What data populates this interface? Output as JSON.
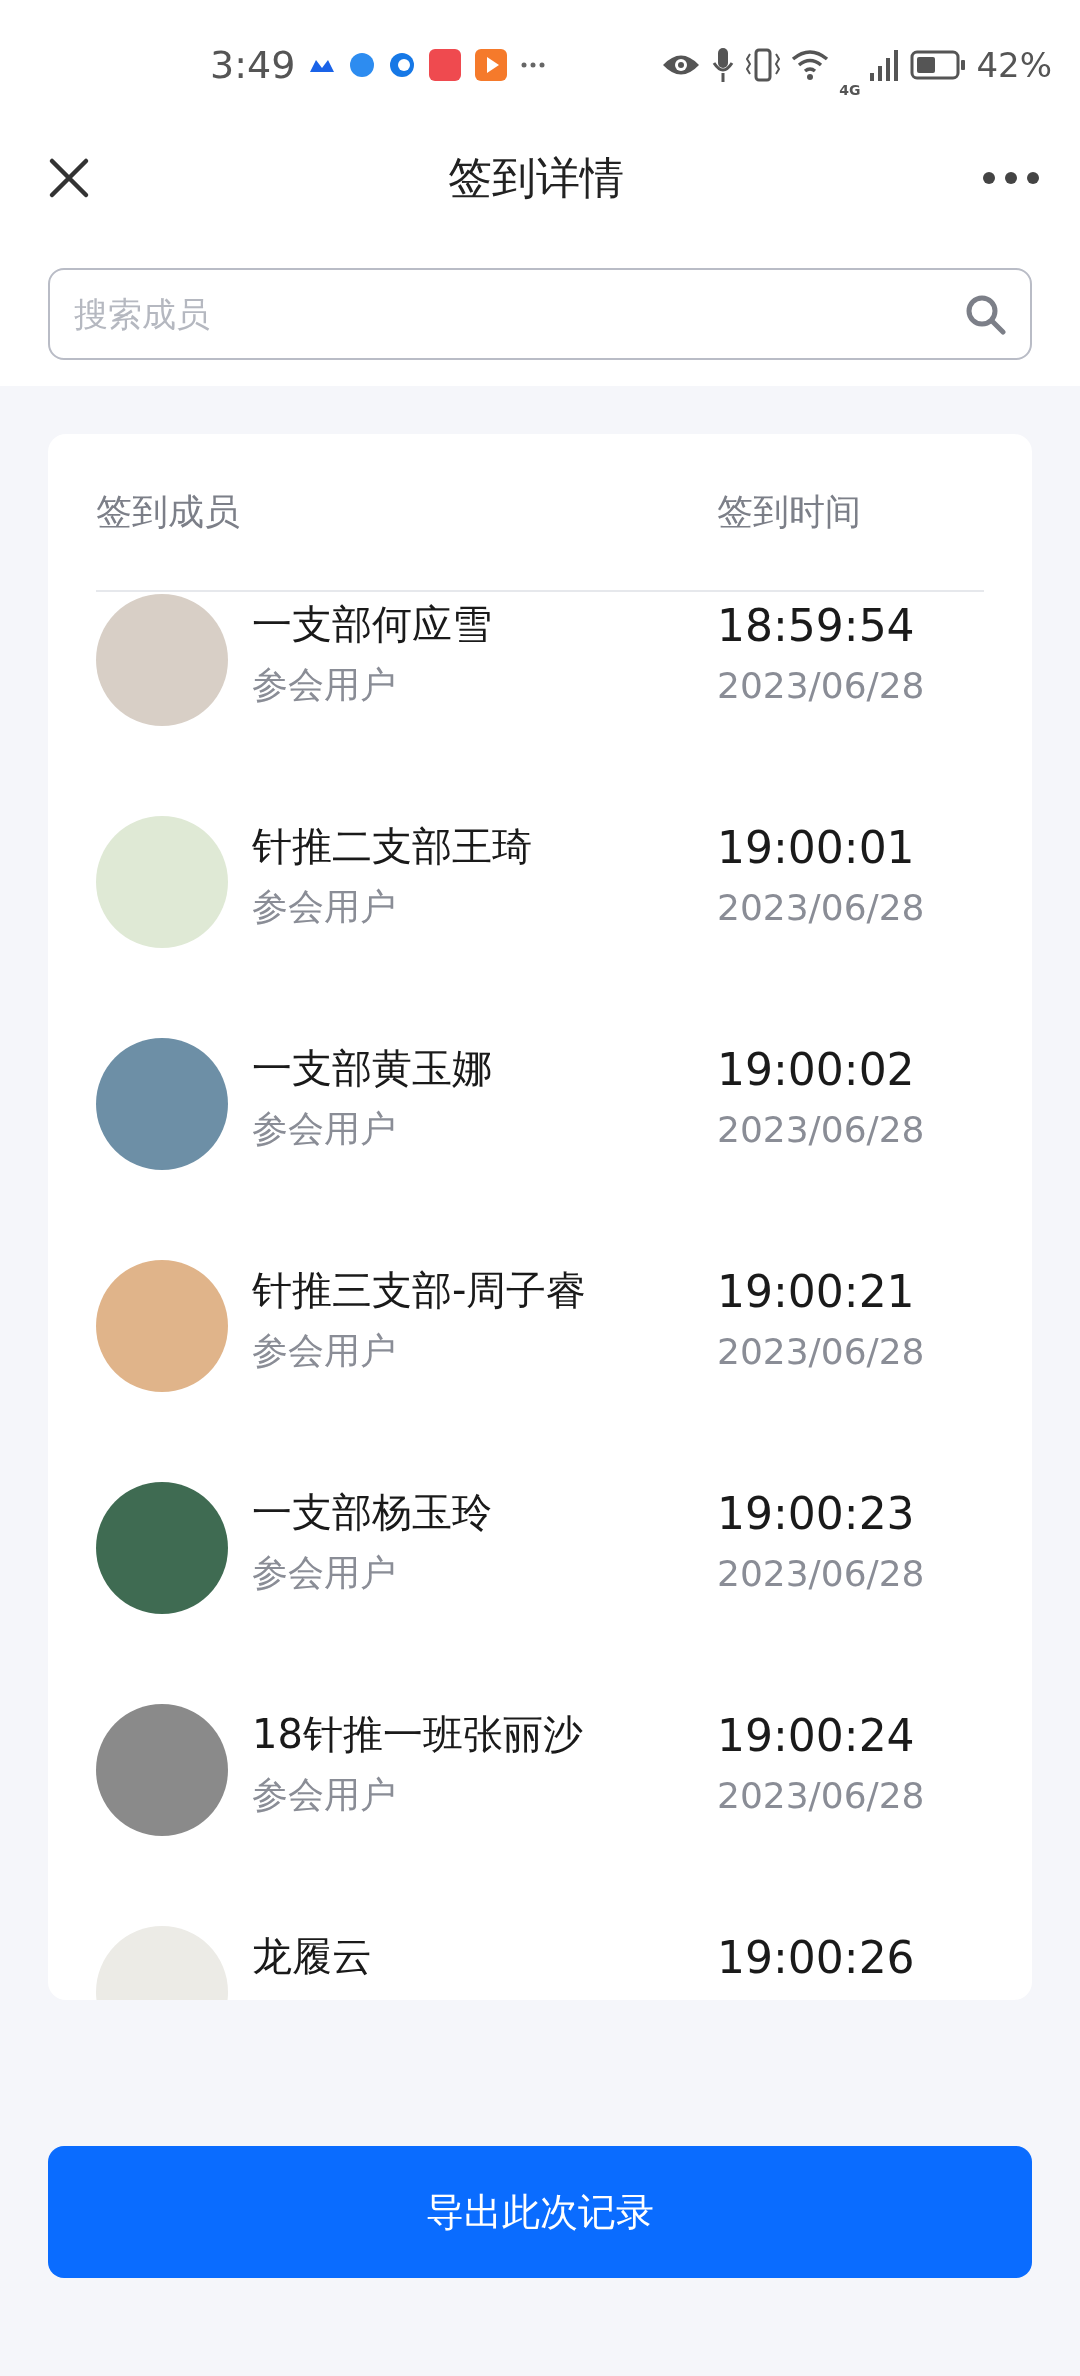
{
  "status_bar": {
    "time": "3:49",
    "battery": "42%",
    "network": "4G"
  },
  "header": {
    "title": "签到详情"
  },
  "search": {
    "placeholder": "搜索成员"
  },
  "table": {
    "columns": [
      "签到成员",
      "签到时间"
    ],
    "rows": [
      {
        "name": "一支部何应雪",
        "role": "参会用户",
        "time": "18:59:54",
        "date": "2023/06/28"
      },
      {
        "name": "针推二支部王琦",
        "role": "参会用户",
        "time": "19:00:01",
        "date": "2023/06/28"
      },
      {
        "name": "一支部黄玉娜",
        "role": "参会用户",
        "time": "19:00:02",
        "date": "2023/06/28"
      },
      {
        "name": "针推三支部-周子睿",
        "role": "参会用户",
        "time": "19:00:21",
        "date": "2023/06/28"
      },
      {
        "name": "一支部杨玉玲",
        "role": "参会用户",
        "time": "19:00:23",
        "date": "2023/06/28"
      },
      {
        "name": "18针推一班张丽沙",
        "role": "参会用户",
        "time": "19:00:24",
        "date": "2023/06/28"
      },
      {
        "name": "龙履云",
        "time": "19:00:26"
      }
    ]
  },
  "export_button": "导出此次记录"
}
